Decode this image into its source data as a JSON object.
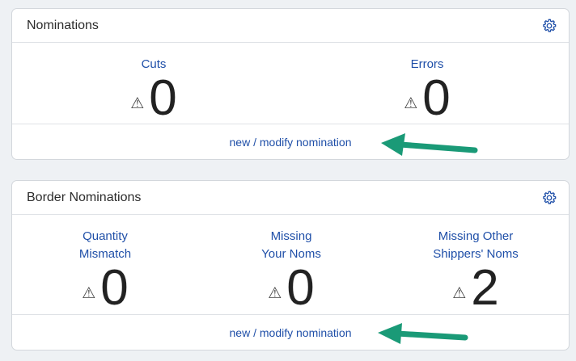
{
  "colors": {
    "link": "#1f4fa8",
    "arrow": "#1a9a77",
    "background": "#eef1f4"
  },
  "nominations": {
    "title": "Nominations",
    "settings_icon": "gear-icon",
    "metrics": [
      {
        "label": "Cuts",
        "warning_icon": "warning-icon",
        "value": "0"
      },
      {
        "label": "Errors",
        "warning_icon": "warning-icon",
        "value": "0"
      }
    ],
    "footer_link": "new / modify nomination"
  },
  "border_nominations": {
    "title": "Border Nominations",
    "settings_icon": "gear-icon",
    "metrics": [
      {
        "label": "Quantity\nMismatch",
        "warning_icon": "warning-icon",
        "value": "0"
      },
      {
        "label": "Missing\nYour Noms",
        "warning_icon": "warning-icon",
        "value": "0"
      },
      {
        "label": "Missing Other\nShippers' Noms",
        "warning_icon": "warning-icon",
        "value": "2"
      }
    ],
    "footer_link": "new / modify nomination"
  }
}
